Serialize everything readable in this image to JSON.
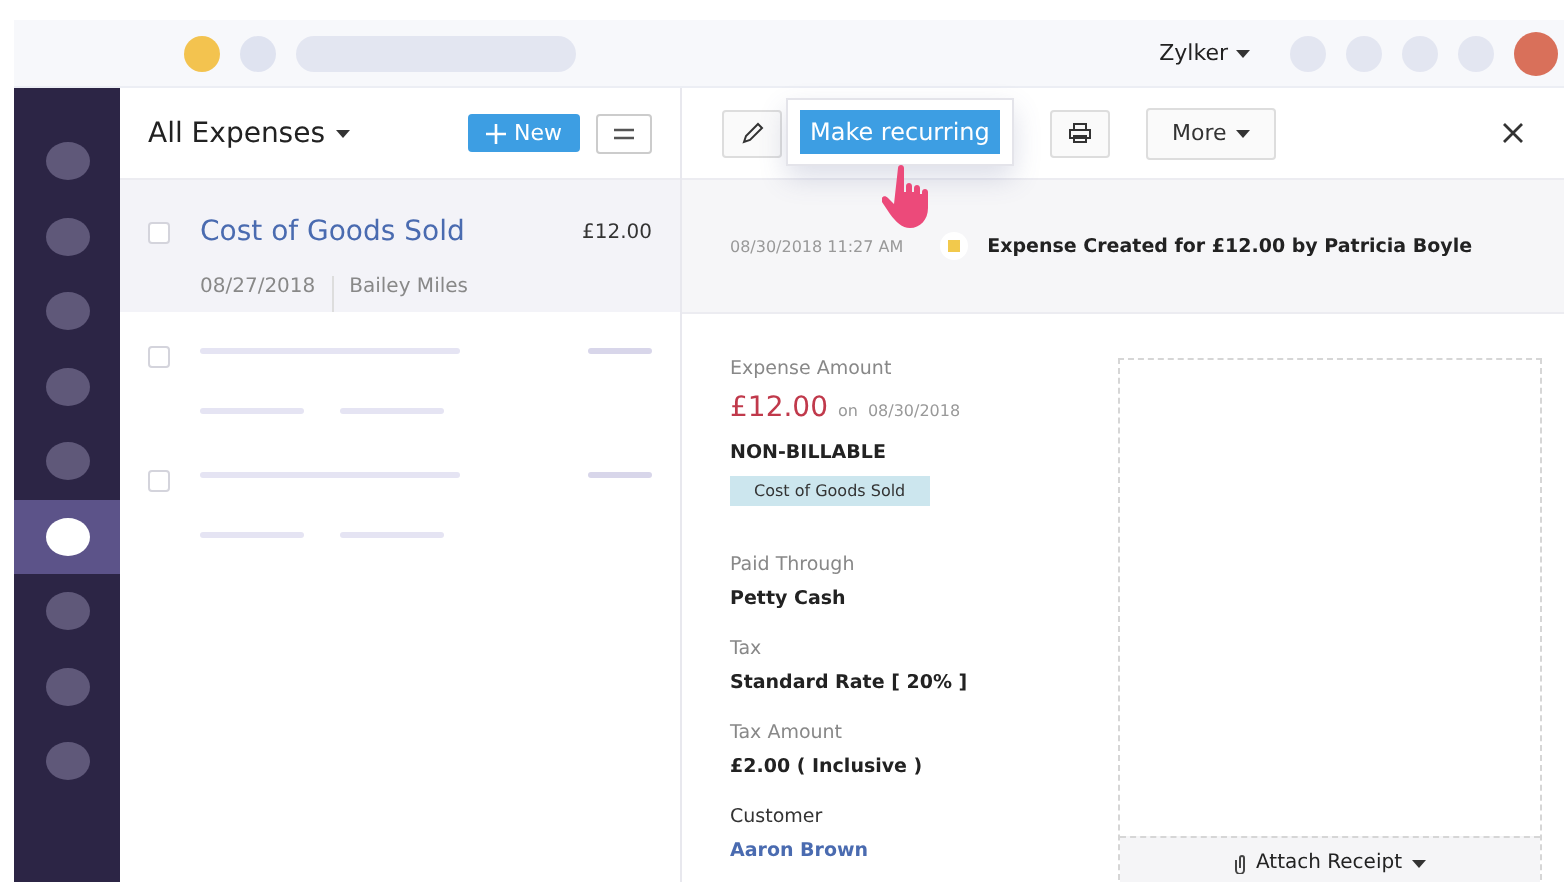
{
  "topbar": {
    "org": "Zylker"
  },
  "sidebar": {
    "items": [
      {
        "selected": false
      },
      {
        "selected": false
      },
      {
        "selected": false
      },
      {
        "selected": false
      },
      {
        "selected": false
      },
      {
        "selected": true
      },
      {
        "selected": false
      },
      {
        "selected": false
      },
      {
        "selected": false
      }
    ]
  },
  "list": {
    "title": "All Expenses",
    "new_button": "New",
    "rows": [
      {
        "name": "Cost of Goods Sold",
        "amount": "£12.00",
        "date": "08/27/2018",
        "person": "Bailey Miles",
        "selected": true,
        "checked": false
      }
    ],
    "placeholder_rows": [
      {
        "checked": false
      },
      {
        "checked": false
      }
    ]
  },
  "toolbar": {
    "popover": "Make recurring",
    "more": "More"
  },
  "history": {
    "time": "08/30/2018 11:27 AM",
    "text": "Expense Created for £12.00 by Patricia Boyle"
  },
  "details": {
    "amount_label": "Expense Amount",
    "amount": "£12.00",
    "on": "on",
    "date": "08/30/2018",
    "billable": "NON-BILLABLE",
    "category": "Cost of Goods Sold",
    "fields": [
      {
        "label": "Paid Through",
        "value": "Petty Cash",
        "kind": "text"
      },
      {
        "label": "Tax",
        "value": "Standard Rate [ 20% ]",
        "kind": "text"
      },
      {
        "label": "Tax Amount",
        "value": "£2.00 ( Inclusive )",
        "kind": "text"
      },
      {
        "label": "Customer",
        "value": "Aaron Brown",
        "kind": "link"
      }
    ]
  },
  "receipt": {
    "button": "Attach Receipt"
  }
}
